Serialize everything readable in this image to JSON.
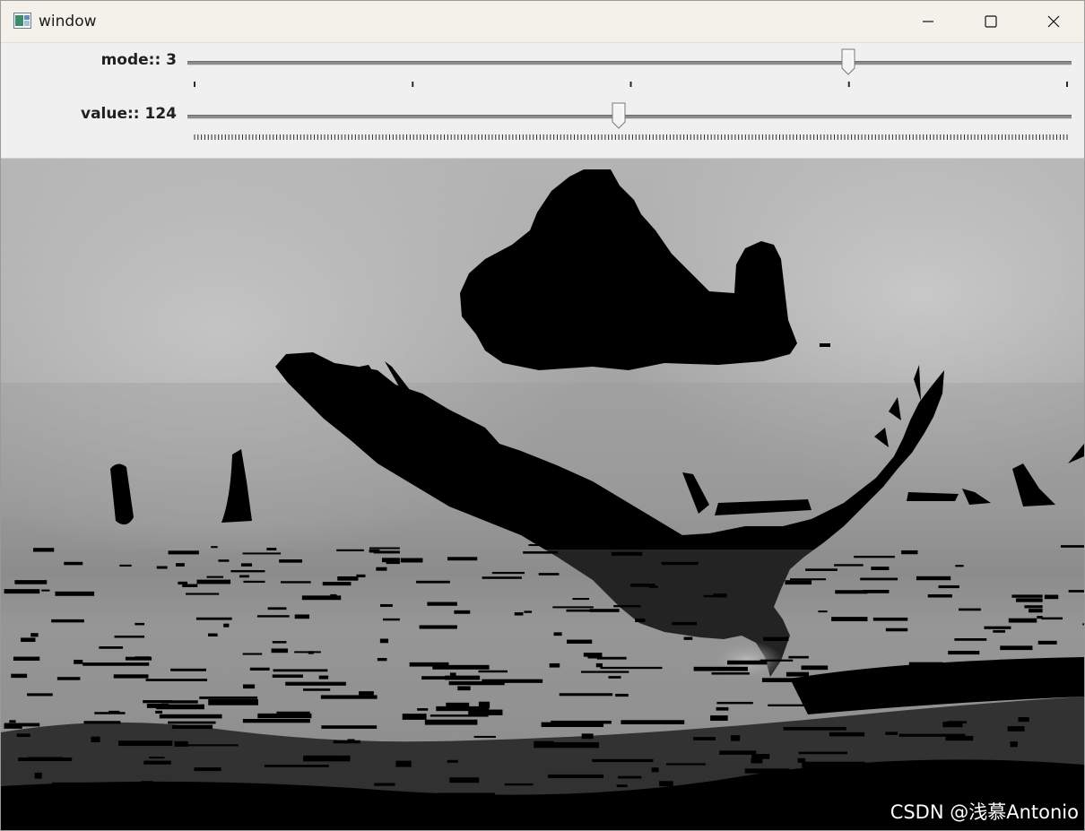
{
  "window": {
    "title": "window",
    "icon": "app-window-icon",
    "controls": {
      "minimize_icon": "minimize-icon",
      "maximize_icon": "maximize-icon",
      "close_icon": "close-icon"
    }
  },
  "trackbars": [
    {
      "label": "mode:: 3",
      "value": 3,
      "min": 0,
      "max": 4,
      "tick_count": 5
    },
    {
      "label": "value:: 124",
      "value": 124,
      "min": 0,
      "max": 255,
      "tick_count": 256
    }
  ],
  "image": {
    "description_icon": "thresholded-eagle-image",
    "watermark": "CSDN @浅慕Antonio"
  },
  "colors": {
    "titlebar": "#f3f1ea",
    "panel": "#f0f0f0",
    "track": "#8c8c8c",
    "silhouette": "#000000"
  }
}
